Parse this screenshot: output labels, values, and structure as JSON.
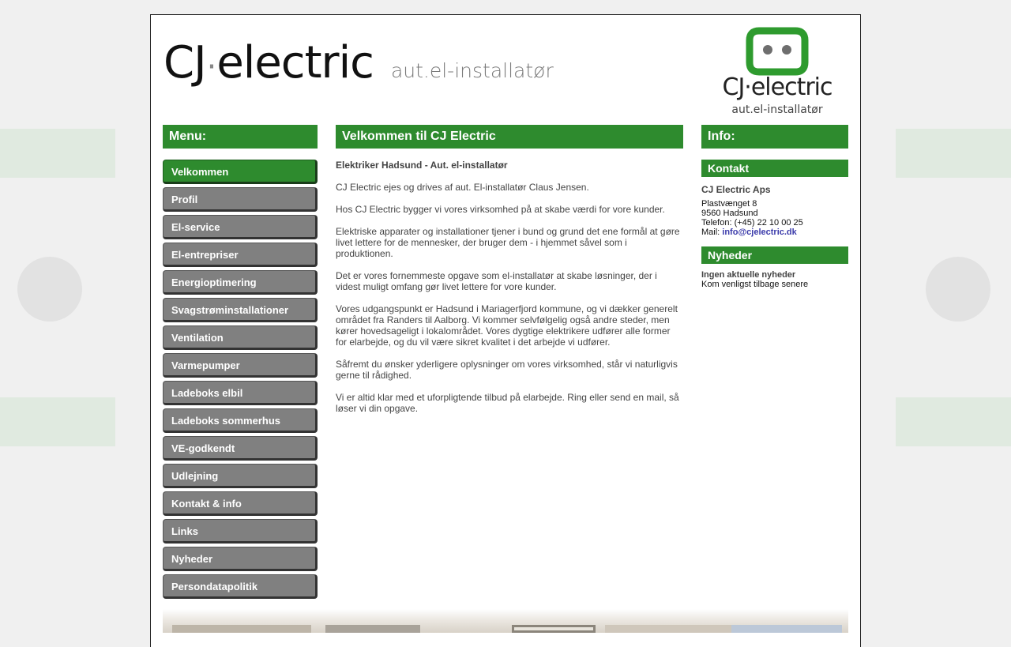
{
  "header": {
    "brand_cj": "CJ",
    "brand_dot": "·",
    "brand_electric": "electric",
    "brand_tagline": "aut.el-installatør",
    "logo_name": "CJ·electric",
    "logo_tagline": "aut.el-installatør"
  },
  "menu": {
    "heading": "Menu:",
    "items": [
      {
        "label": "Velkommen",
        "active": true
      },
      {
        "label": "Profil"
      },
      {
        "label": "El-service"
      },
      {
        "label": "El-entrepriser"
      },
      {
        "label": "Energioptimering"
      },
      {
        "label": "Svagstrøminstallationer"
      },
      {
        "label": "Ventilation"
      },
      {
        "label": "Varmepumper"
      },
      {
        "label": "Ladeboks elbil"
      },
      {
        "label": "Ladeboks sommerhus"
      },
      {
        "label": "VE-godkendt"
      },
      {
        "label": "Udlejning"
      },
      {
        "label": "Kontakt & info"
      },
      {
        "label": "Links"
      },
      {
        "label": "Nyheder"
      },
      {
        "label": "Persondatapolitik"
      }
    ]
  },
  "main": {
    "heading": "Velkommen til CJ Electric",
    "lead": "Elektriker Hadsund - Aut. el-installatør",
    "paragraphs": [
      "CJ Electric ejes og drives af aut. El-installatør Claus Jensen.",
      "Hos CJ Electric bygger vi vores virksomhed på at skabe værdi for vore kunder.",
      "Elektriske apparater og installationer tjener i bund og grund det ene formål at gøre livet lettere for de mennesker, der bruger dem - i hjemmet såvel som i produktionen.",
      "Det er vores fornemmeste opgave som el-installatør at skabe løsninger, der i videst muligt omfang gør livet lettere for vore kunder.",
      "Vores udgangspunkt er Hadsund i Mariagerfjord kommune, og vi dækker generelt området fra Randers til Aalborg. Vi kommer selvfølgelig også andre steder, men kører hovedsageligt i lokalområdet. Vores dygtige elektrikere udfører alle former for elarbejde, og du vil være sikret kvalitet i det arbejde vi udfører.",
      "Såfremt du ønsker yderligere oplysninger om vores virksomhed, står vi naturligvis gerne til rådighed.",
      "Vi er altid klar med et uforpligtende tilbud på elarbejde. Ring eller send en mail, så løser vi din opgave."
    ]
  },
  "info": {
    "heading": "Info:",
    "contact_heading": "Kontakt",
    "company": "CJ Electric Aps",
    "street": "Plastvænget 8",
    "city": "9560 Hadsund",
    "phone": "Telefon: (+45) 22 10 00 25",
    "mail_label": "Mail: ",
    "mail": "info@cjelectric.dk",
    "news_heading": "Nyheder",
    "news_title": "Ingen aktuelle nyheder",
    "news_text": "Kom venligst tilbage senere"
  },
  "colors": {
    "green": "#2e8b2e",
    "menu_grey": "#808080",
    "link": "#3a3aaa"
  }
}
